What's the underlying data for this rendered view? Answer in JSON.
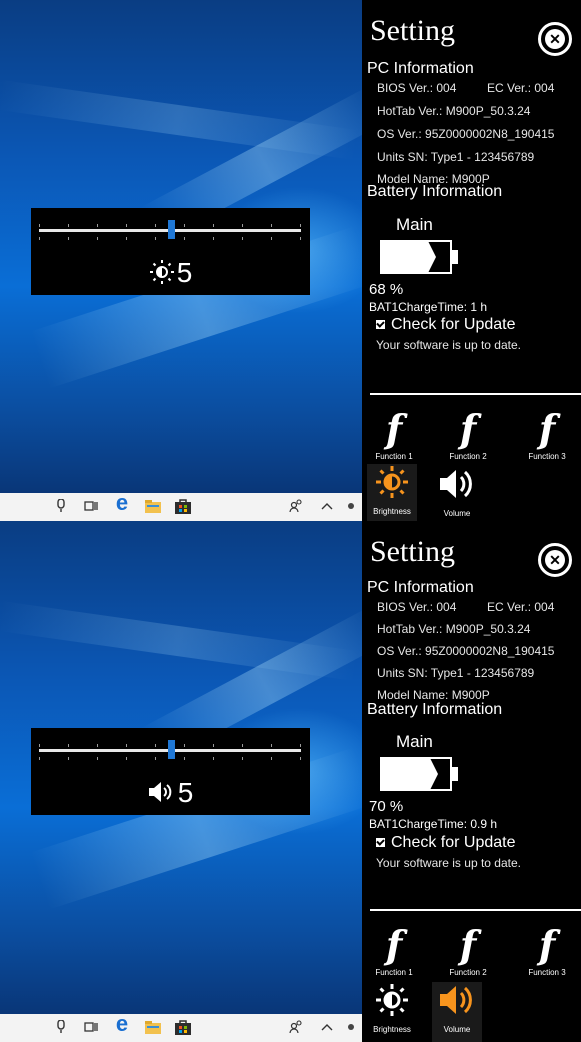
{
  "panels": [
    {
      "osd": {
        "value": "5",
        "mode": "brightness",
        "icon": "brightness-icon"
      },
      "taskbar": {
        "icons": [
          "microphone-icon",
          "task-view-icon",
          "edge-icon",
          "file-explorer-icon",
          "store-icon",
          "people-icon",
          "chevron-up-icon"
        ]
      },
      "settings": {
        "title": "Setting",
        "close_icon": "close-icon",
        "pc_info_header": "PC Information",
        "bios": "BIOS Ver.: 004",
        "ec": "EC Ver.: 004",
        "hottab": "HotTab Ver.: M900P_50.3.24",
        "os": "OS Ver.: 95Z0000002N8_190415",
        "units_sn": "Units SN: Type1 - 123456789",
        "model": "Model Name: M900P",
        "battery_header": "Battery Information",
        "battery_main": "Main",
        "battery_percent": "68 %",
        "battery_level": 0.68,
        "charge_time": "BAT1ChargeTime: 1 h",
        "check_update": "Check for Update",
        "update_status": "Your software is up to date.",
        "functions": [
          {
            "label": "Function 1"
          },
          {
            "label": "Function 2"
          },
          {
            "label": "Function 3"
          }
        ],
        "quick": [
          {
            "label": "Brightness",
            "active": true,
            "color": "#f7941d"
          },
          {
            "label": "Volume",
            "active": false,
            "color": "#ffffff"
          }
        ]
      }
    },
    {
      "osd": {
        "value": "5",
        "mode": "volume",
        "icon": "volume-icon"
      },
      "taskbar": {
        "icons": [
          "microphone-icon",
          "task-view-icon",
          "edge-icon",
          "file-explorer-icon",
          "store-icon",
          "people-icon",
          "chevron-up-icon"
        ]
      },
      "settings": {
        "title": "Setting",
        "close_icon": "close-icon",
        "pc_info_header": "PC Information",
        "bios": "BIOS Ver.: 004",
        "ec": "EC Ver.: 004",
        "hottab": "HotTab Ver.: M900P_50.3.24",
        "os": "OS Ver.: 95Z0000002N8_190415",
        "units_sn": "Units SN: Type1 - 123456789",
        "model": "Model Name: M900P",
        "battery_header": "Battery Information",
        "battery_main": "Main",
        "battery_percent": "70 %",
        "battery_level": 0.7,
        "charge_time": "BAT1ChargeTime: 0.9 h",
        "check_update": "Check for Update",
        "update_status": "Your software is up to date.",
        "functions": [
          {
            "label": "Function 1"
          },
          {
            "label": "Function 2"
          },
          {
            "label": "Function 3"
          }
        ],
        "quick": [
          {
            "label": "Brightness",
            "active": false,
            "color": "#ffffff"
          },
          {
            "label": "Volume",
            "active": true,
            "color": "#f7941d"
          }
        ]
      }
    }
  ],
  "colors": {
    "accent": "#f7941d",
    "slider_thumb": "#1f78d6",
    "panel_bg": "#000000"
  }
}
